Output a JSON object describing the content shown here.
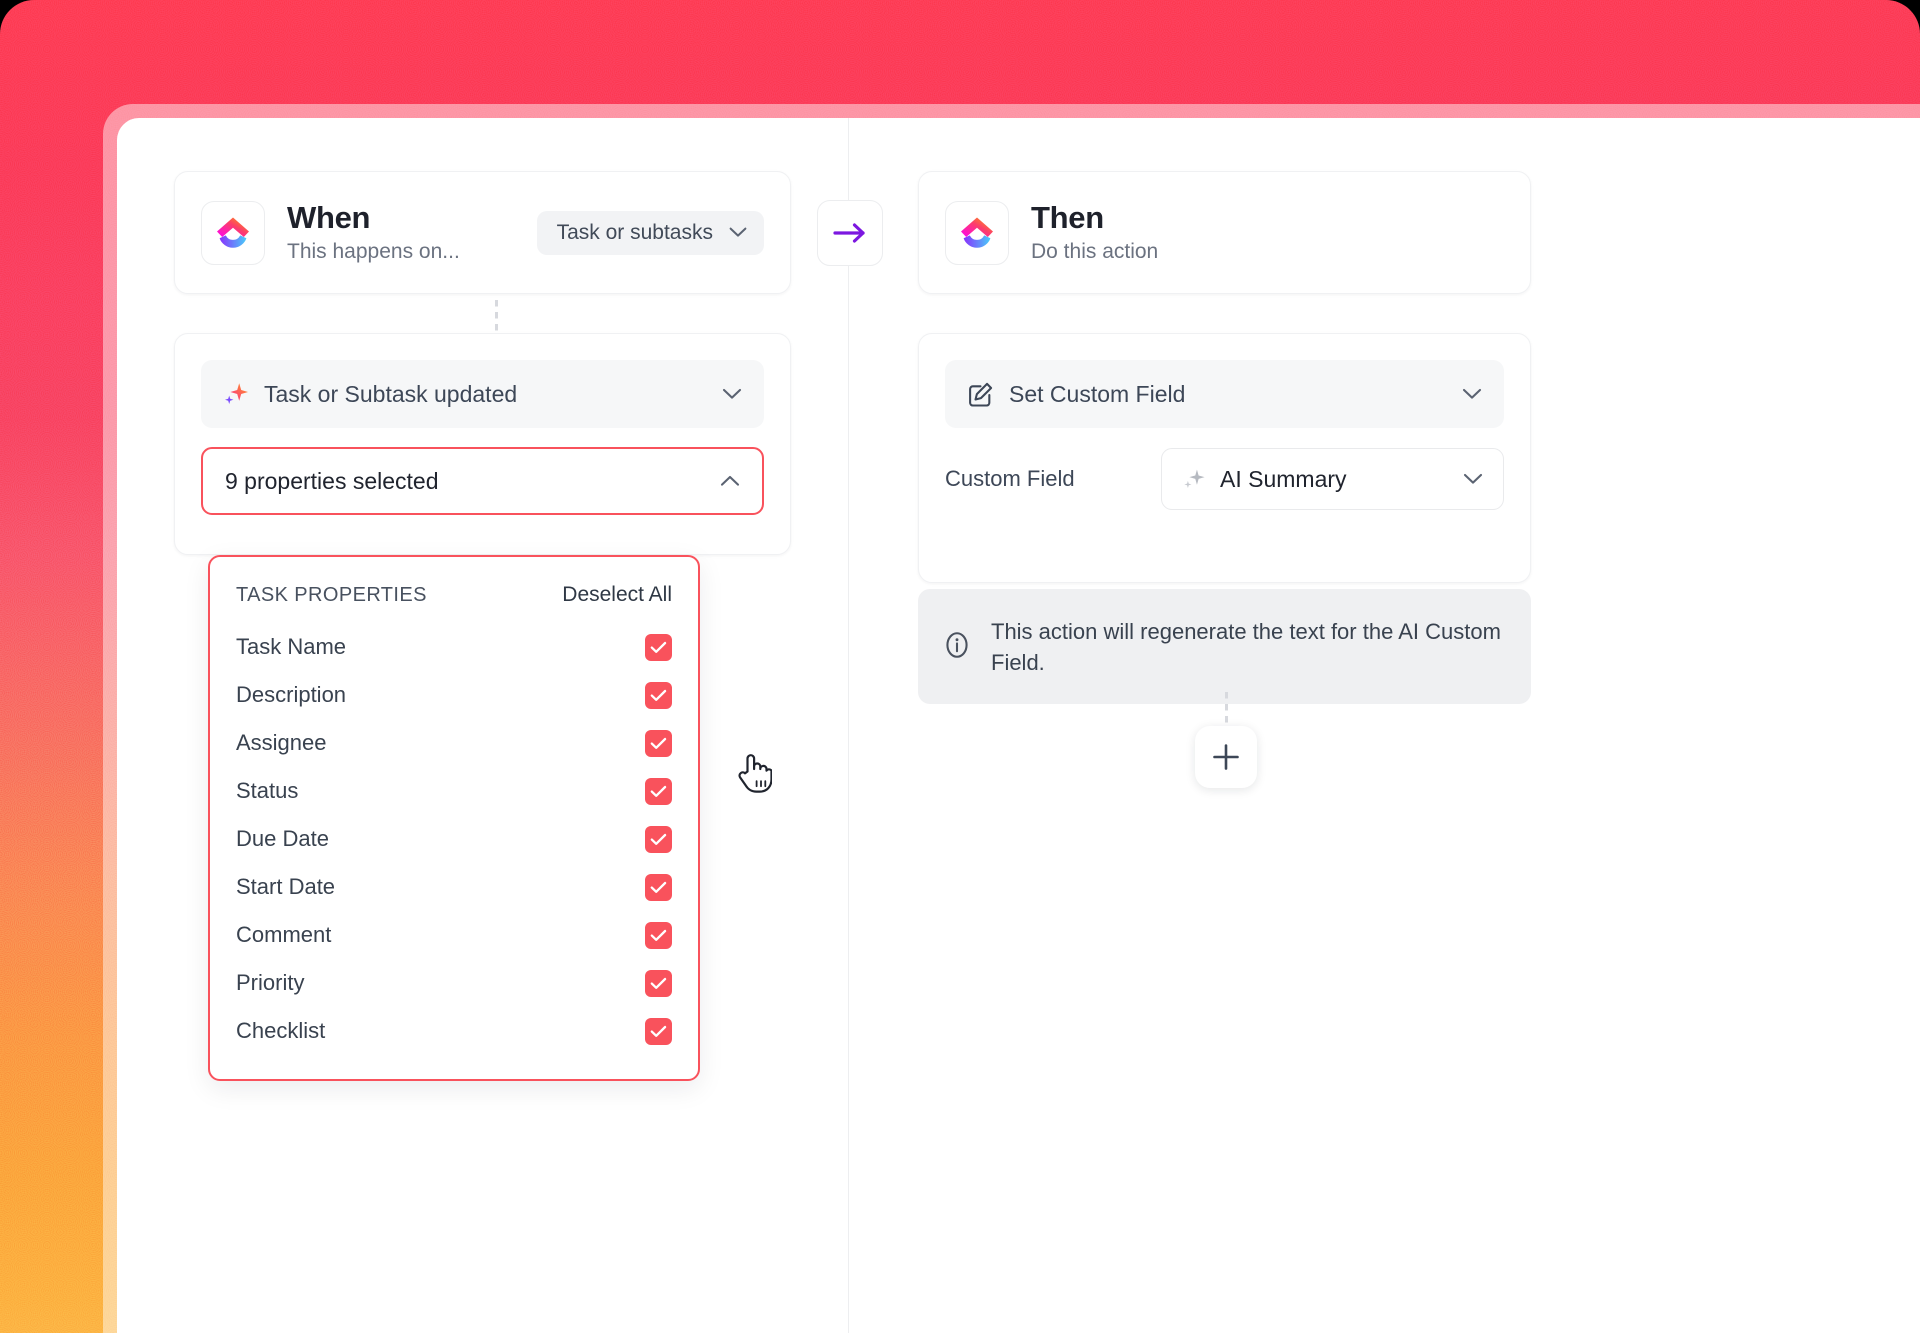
{
  "background": {
    "gradient_top": "#fe3b52",
    "gradient_bottom": "#fdb84a"
  },
  "accent": {
    "red": "#f9525c",
    "purple": "#7c17e0"
  },
  "when_panel": {
    "header": {
      "title": "When",
      "subtitle": "This happens on...",
      "logo_icon": "clickup-logo-icon",
      "trigger_scope": {
        "value": "Task or subtasks",
        "chevron_icon": "chevron-down-icon"
      }
    },
    "trigger": {
      "icon": "ai-sparkle-icon",
      "label": "Task or Subtask updated",
      "chevron_icon": "chevron-down-icon"
    },
    "properties_select": {
      "value": "9 properties selected",
      "chevron_icon": "chevron-up-icon"
    },
    "dropdown": {
      "title": "TASK PROPERTIES",
      "deselect_all": "Deselect All",
      "items": [
        {
          "label": "Task Name",
          "checked": true
        },
        {
          "label": "Description",
          "checked": true
        },
        {
          "label": "Assignee",
          "checked": true
        },
        {
          "label": "Status",
          "checked": true
        },
        {
          "label": "Due Date",
          "checked": true
        },
        {
          "label": "Start Date",
          "checked": true
        },
        {
          "label": "Comment",
          "checked": true
        },
        {
          "label": "Priority",
          "checked": true
        },
        {
          "label": "Checklist",
          "checked": true
        }
      ]
    }
  },
  "connector": {
    "arrow_icon": "arrow-right-icon"
  },
  "then_panel": {
    "header": {
      "title": "Then",
      "subtitle": "Do this action",
      "logo_icon": "clickup-logo-icon"
    },
    "action": {
      "icon": "edit-square-icon",
      "label": "Set Custom Field",
      "chevron_icon": "chevron-down-icon"
    },
    "custom_field": {
      "label": "Custom Field",
      "icon": "ai-sparkle-icon",
      "value": "AI Summary",
      "chevron_icon": "chevron-down-icon"
    },
    "notice": {
      "icon": "info-circle-icon",
      "text": "This action will regenerate the text for the AI Custom Field."
    },
    "add_step": {
      "icon": "plus-icon"
    }
  }
}
